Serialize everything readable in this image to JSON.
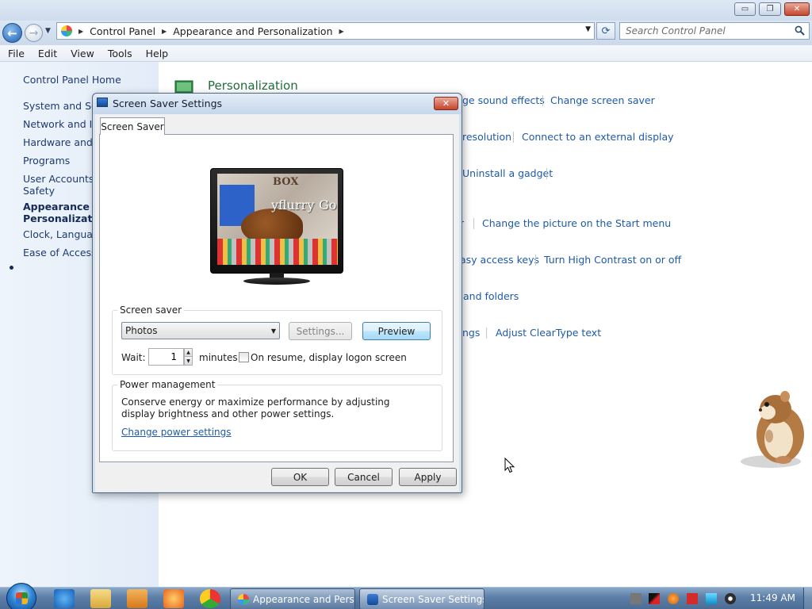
{
  "window": {
    "minimize_glyph": "▭",
    "maximize_glyph": "❐",
    "close_glyph": "✕"
  },
  "navigation": {
    "back_glyph": "←",
    "forward_glyph": "→",
    "history_glyph": "▼",
    "breadcrumb": [
      "Control Panel",
      "Appearance and Personalization"
    ],
    "breadcrumb_sep": "▶",
    "address_drop_glyph": "▼",
    "refresh_glyph": "⟳",
    "search_placeholder": "Search Control Panel"
  },
  "menubar": [
    "File",
    "Edit",
    "View",
    "Tools",
    "Help"
  ],
  "sidebar": {
    "home": "Control Panel Home",
    "items": [
      "System and Security",
      "Network and Internet",
      "Hardware and Sound",
      "Programs",
      "User Accounts and Family Safety",
      "Appearance and Personalization",
      "Clock, Language, and Region",
      "Ease of Access"
    ],
    "current_index": 5
  },
  "main": {
    "section_title": "Personalization",
    "links": {
      "sound_effects": "ge sound effects",
      "screen_saver": "Change screen saver",
      "resolution": "resolution",
      "external_display": "Connect to an external display",
      "uninstall_gadget": "Uninstall a gadget",
      "r_fragment": "r",
      "start_menu_picture": "Change the picture on the Start menu",
      "easy_access_keys": "asy access keys",
      "high_contrast": "Turn High Contrast on or off",
      "folders": "and folders",
      "ngs": "ngs",
      "cleartype": "Adjust ClearType text"
    }
  },
  "dialog": {
    "title": "Screen Saver Settings",
    "close_glyph": "✕",
    "tab": "Screen Saver",
    "preview_texts": [
      "BOX",
      "yflurry",
      "Go"
    ],
    "screen_saver_group": "Screen saver",
    "selected_saver": "Photos",
    "select_arrow": "▼",
    "settings_label": "Settings...",
    "preview_label": "Preview",
    "wait_label": "Wait:",
    "wait_value": "1",
    "spin_up": "▲",
    "spin_down": "▼",
    "minutes_label": "minutes",
    "logon_label": "On resume, display logon screen",
    "logon_checked": false,
    "power_group": "Power management",
    "power_desc": "Conserve energy or maximize performance by adjusting display brightness and other power settings.",
    "power_link": "Change power settings",
    "ok": "OK",
    "cancel": "Cancel",
    "apply": "Apply"
  },
  "taskbar": {
    "tasks": [
      "Appearance and Pers...",
      "Screen Saver Settings"
    ],
    "active_task_index": 1,
    "clock": "11:49 AM"
  },
  "colors": {
    "link": "#1e5aa8",
    "section_title": "#1e6e3b",
    "sidebar_text": "#1e3a6e"
  }
}
